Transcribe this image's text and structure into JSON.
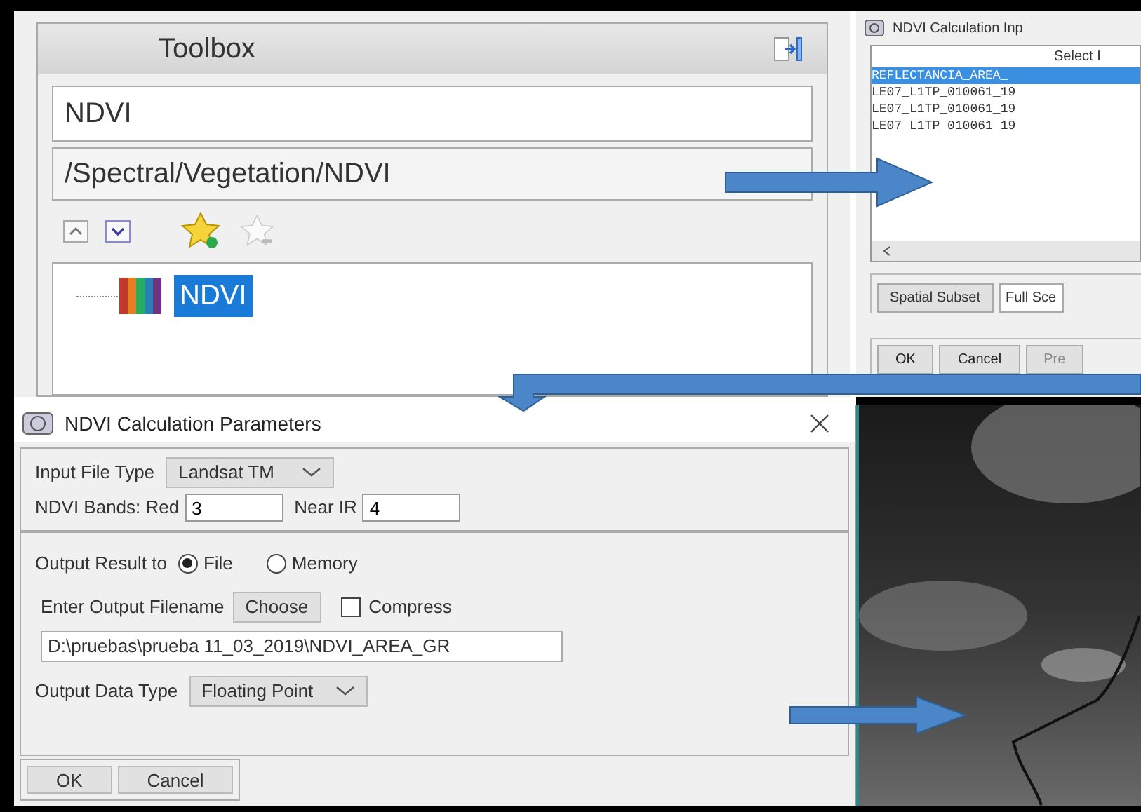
{
  "toolbox": {
    "title": "Toolbox",
    "search": "NDVI",
    "path": "/Spectral/Vegetation/NDVI",
    "tree": [
      {
        "label": "NDVI",
        "selected": true
      }
    ]
  },
  "input_dialog": {
    "title": "NDVI Calculation Inp",
    "list_header": "Select I",
    "files": [
      {
        "label": "REFLECTANCIA_AREA_",
        "selected": true
      },
      {
        "label": "LE07_L1TP_010061_19",
        "selected": false
      },
      {
        "label": "LE07_L1TP_010061_19",
        "selected": false
      },
      {
        "label": "LE07_L1TP_010061_19",
        "selected": false
      }
    ],
    "subset_button": "Spatial Subset",
    "subset_value": "Full Sce",
    "buttons": [
      {
        "label": "OK",
        "disabled": false
      },
      {
        "label": "Cancel",
        "disabled": false
      },
      {
        "label": "Pre",
        "disabled": true
      }
    ]
  },
  "params_dialog": {
    "title": "NDVI Calculation Parameters",
    "input_file_type": {
      "label": "Input File Type",
      "value": "Landsat TM"
    },
    "bands_label": "NDVI Bands: Red",
    "red": "3",
    "nir_label": "Near IR",
    "nir": "4",
    "output_label": "Output Result to",
    "outputs": [
      {
        "label": "File",
        "selected": true
      },
      {
        "label": "Memory",
        "selected": false
      }
    ],
    "filename_label": "Enter Output Filename",
    "choose": "Choose",
    "compress": {
      "label": "Compress",
      "checked": false
    },
    "filename": "D:\\pruebas\\prueba 11_03_2019\\NDVI_AREA_GR",
    "data_type": {
      "label": "Output Data Type",
      "value": "Floating Point"
    },
    "buttons": [
      "OK",
      "Cancel"
    ]
  }
}
